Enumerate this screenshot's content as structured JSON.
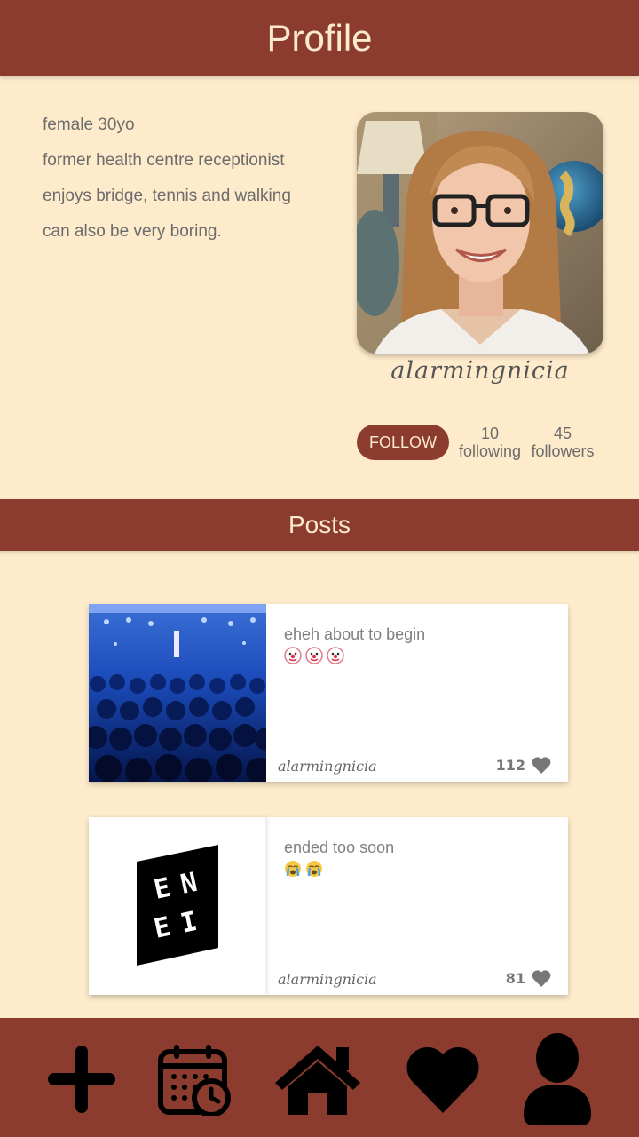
{
  "header": {
    "title": "Profile"
  },
  "profile": {
    "bio": [
      "female 30yo",
      "former health centre receptionist",
      "enjoys bridge, tennis and walking",
      "can also be very boring."
    ],
    "username": "alarmingnicia",
    "follow_label": "FOLLOW",
    "following_count": "10",
    "following_label": "following",
    "followers_count": "45",
    "followers_label": "followers"
  },
  "posts_section": {
    "title": "Posts"
  },
  "posts": [
    {
      "text": "eheh about to begin",
      "emojis": "🤡🤡🤡",
      "author": "alarmingnicia",
      "likes": "112"
    },
    {
      "text": "ended too soon",
      "emojis": "😭😭",
      "author": "alarmingnicia",
      "likes": "81",
      "logo_text": "EN EI"
    }
  ],
  "nav": {
    "items": [
      "add-icon",
      "calendar-clock-icon",
      "home-icon",
      "heart-icon",
      "user-icon"
    ]
  },
  "colors": {
    "brand": "#8C3C2F",
    "background": "#FDEBCB"
  }
}
